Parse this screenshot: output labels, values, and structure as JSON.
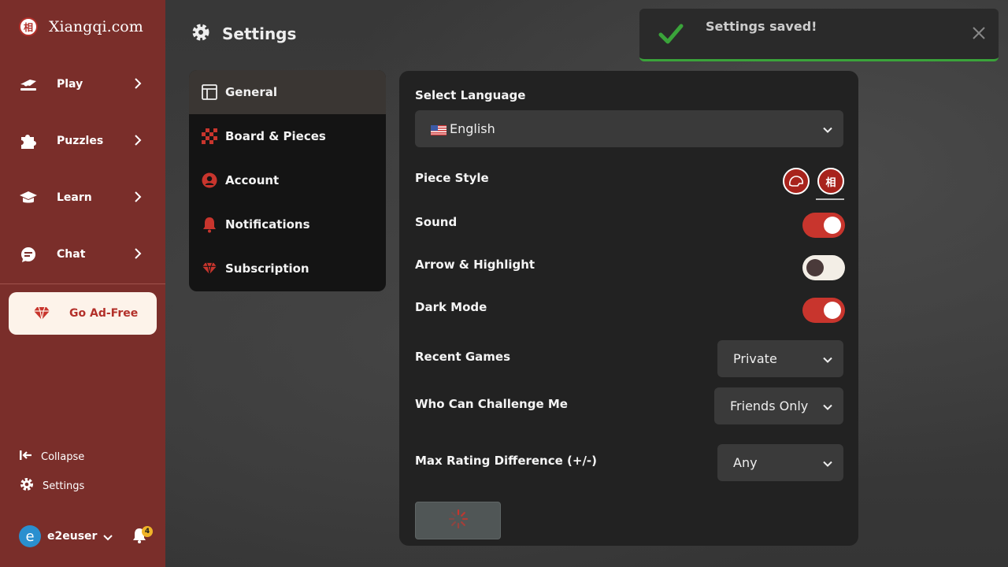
{
  "brand": {
    "name": "Xiangqi.com",
    "logo_glyph": "相"
  },
  "sidebar": {
    "items": [
      {
        "label": "Play",
        "icon": "play-icon"
      },
      {
        "label": "Puzzles",
        "icon": "puzzle-icon"
      },
      {
        "label": "Learn",
        "icon": "graduation-cap-icon"
      },
      {
        "label": "Chat",
        "icon": "chat-icon"
      }
    ],
    "ad_free_label": "Go Ad-Free",
    "collapse_label": "Collapse",
    "settings_label": "Settings",
    "username": "e2euser",
    "avatar_letter": "e",
    "notification_count": "4"
  },
  "header": {
    "title": "Settings"
  },
  "settings_menu": {
    "items": [
      {
        "label": "General",
        "icon": "layout-icon",
        "active": true
      },
      {
        "label": "Board & Pieces",
        "icon": "checkerboard-icon",
        "active": false
      },
      {
        "label": "Account",
        "icon": "user-icon",
        "active": false
      },
      {
        "label": "Notifications",
        "icon": "bell-icon",
        "active": false
      },
      {
        "label": "Subscription",
        "icon": "gem-icon",
        "active": false
      }
    ]
  },
  "general": {
    "language_label": "Select Language",
    "language_value": "English",
    "piece_style_label": "Piece Style",
    "piece_glyph": "相",
    "sound_label": "Sound",
    "sound_on": true,
    "arrow_label": "Arrow & Highlight",
    "arrow_on": false,
    "dark_mode_label": "Dark Mode",
    "dark_mode_on": true,
    "recent_games_label": "Recent Games",
    "recent_games_value": "Private",
    "challenge_label": "Who Can Challenge Me",
    "challenge_value": "Friends Only",
    "rating_diff_label": "Max Rating Difference (+/-)",
    "rating_diff_value": "Any"
  },
  "toast": {
    "message": "Settings saved!"
  },
  "colors": {
    "sidebar": "#7a2e2a",
    "accent": "#c8352d",
    "success": "#3aa33a"
  }
}
